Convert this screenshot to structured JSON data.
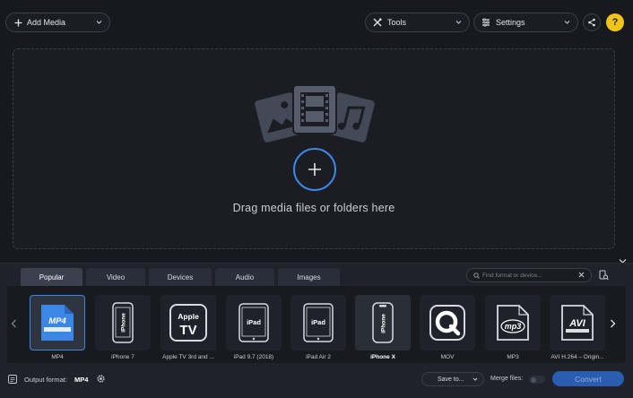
{
  "toolbar": {
    "add_media_label": "Add Media",
    "tools_label": "Tools",
    "settings_label": "Settings"
  },
  "dropzone": {
    "text": "Drag media files or folders here"
  },
  "tabs": [
    {
      "label": "Popular",
      "active": true
    },
    {
      "label": "Video",
      "active": false
    },
    {
      "label": "Devices",
      "active": false
    },
    {
      "label": "Audio",
      "active": false
    },
    {
      "label": "Images",
      "active": false
    }
  ],
  "search": {
    "placeholder": "Find format or device..."
  },
  "formats": [
    {
      "label": "MP4",
      "icon": "mp4-video-icon",
      "badge": "MP4",
      "selected": true
    },
    {
      "label": "iPhone 7",
      "icon": "iphone-icon",
      "badge": "iPhone"
    },
    {
      "label": "Apple TV 3rd and ...",
      "icon": "apple-tv-icon",
      "badge_line1": "Apple",
      "badge_line2": "TV"
    },
    {
      "label": "iPad 9.7 (2018)",
      "icon": "ipad-icon",
      "badge": "iPad"
    },
    {
      "label": "iPad Air 2",
      "icon": "ipad-icon",
      "badge": "iPad"
    },
    {
      "label": "iPhone X",
      "icon": "iphone-icon",
      "badge": "iPhone",
      "highlighted": true
    },
    {
      "label": "MOV",
      "icon": "quicktime-icon"
    },
    {
      "label": "MP3",
      "icon": "mp3-audio-icon",
      "badge": "mp3"
    },
    {
      "label": "AVI H.264 – Origin...",
      "icon": "avi-video-icon",
      "badge": "AVI"
    }
  ],
  "footer": {
    "output_format_label": "Output format:",
    "output_format_value": "MP4",
    "save_to_label": "Save to...",
    "merge_files_label": "Merge files:",
    "convert_label": "Convert"
  },
  "colors": {
    "background": "#17191f",
    "accent": "#3c86e6",
    "convert_button": "#2a5db0",
    "help_button": "#f0c419"
  }
}
